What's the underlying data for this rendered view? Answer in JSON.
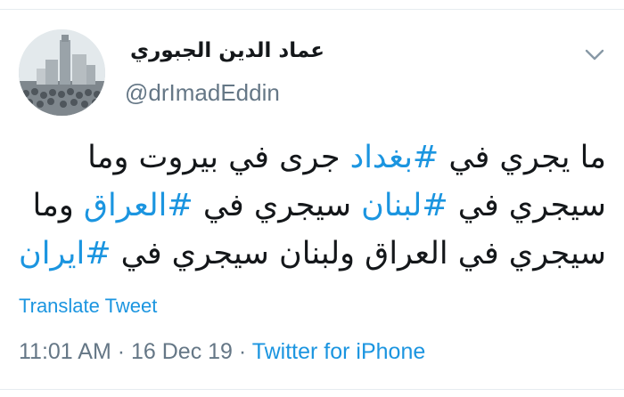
{
  "tweet": {
    "display_name": "عماد الدين الجبوري",
    "handle": "@drImadEddin",
    "avatar_icon": "profile-photo",
    "menu_icon": "chevron-down-icon",
    "body": {
      "line1": {
        "p1": "ما يجري في ",
        "tag1": "#بغداد",
        "p2": " جرى في بيروت وما"
      },
      "line2": {
        "p1": "سيجري في ",
        "tag1": "#لبنان",
        "p2": " سيجري في ",
        "tag2": "#العراق",
        "p3": " وما"
      },
      "line3": {
        "p1": "سيجري في العراق ولبنان سيجري في ",
        "tag1": "#ايران"
      }
    },
    "translate_label": "Translate Tweet",
    "time": "11:01 AM",
    "separator1": " · ",
    "date": "16 Dec 19",
    "separator2": " · ",
    "source": "Twitter for iPhone"
  },
  "colors": {
    "link": "#1b95e0",
    "secondary_text": "#657786",
    "primary_text": "#14171a",
    "divider": "#e6ecf0"
  }
}
